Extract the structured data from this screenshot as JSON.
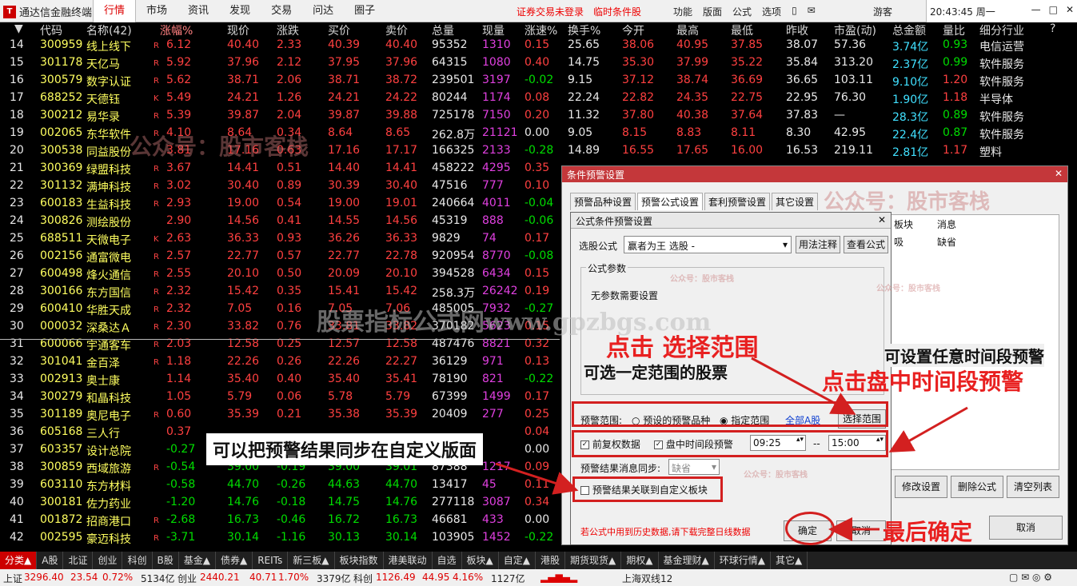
{
  "menubar": {
    "app_title": "通达信金融终端",
    "nav": [
      "行情",
      "市场",
      "资讯",
      "发现",
      "交易",
      "问达",
      "圈子"
    ],
    "warning": "证券交易未登录　临时条件股",
    "tools": [
      "功能",
      "版面",
      "公式",
      "选项"
    ],
    "user": "游客",
    "clock": "20:43:45 周一"
  },
  "table": {
    "headers": [
      "代码",
      "名称(42)",
      "涨幅%",
      "现价",
      "涨跌",
      "买价",
      "卖价",
      "总量",
      "现量",
      "涨速%",
      "换手%",
      "今开",
      "最高",
      "最低",
      "昨收",
      "市盈(动)",
      "总金额",
      "量比",
      "细分行业"
    ],
    "rows": [
      [
        "14",
        "300959",
        "线上线下",
        "R",
        "6.12",
        "40.40",
        "2.33",
        "40.39",
        "40.40",
        "95352",
        "1310",
        "0.15",
        "25.65",
        "38.06",
        "40.95",
        "37.85",
        "38.07",
        "57.36",
        "3.74亿",
        "0.93",
        "电信运营"
      ],
      [
        "15",
        "301178",
        "天亿马",
        "R",
        "5.92",
        "37.96",
        "2.12",
        "37.95",
        "37.96",
        "64315",
        "1080",
        "0.40",
        "14.75",
        "35.30",
        "37.99",
        "35.22",
        "35.84",
        "313.20",
        "2.37亿",
        "0.99",
        "软件服务"
      ],
      [
        "16",
        "300579",
        "数字认证",
        "R",
        "5.62",
        "38.71",
        "2.06",
        "38.71",
        "38.72",
        "239501",
        "3197",
        "-0.02",
        "9.15",
        "37.12",
        "38.74",
        "36.69",
        "36.65",
        "103.11",
        "9.10亿",
        "1.20",
        "软件服务"
      ],
      [
        "17",
        "688252",
        "天德钰",
        "K",
        "5.49",
        "24.21",
        "1.26",
        "24.21",
        "24.22",
        "80244",
        "1174",
        "0.08",
        "22.24",
        "22.82",
        "24.35",
        "22.75",
        "22.95",
        "76.30",
        "1.90亿",
        "1.18",
        "半导体"
      ],
      [
        "18",
        "300212",
        "易华录",
        "R",
        "5.39",
        "39.87",
        "2.04",
        "39.87",
        "39.88",
        "725178",
        "7150",
        "0.20",
        "11.32",
        "37.80",
        "40.38",
        "37.64",
        "37.83",
        "—",
        "28.3亿",
        "0.89",
        "软件服务"
      ],
      [
        "19",
        "002065",
        "东华软件",
        "R",
        "4.10",
        "8.64",
        "0.34",
        "8.64",
        "8.65",
        "262.8万",
        "21121",
        "0.00",
        "9.05",
        "8.15",
        "8.83",
        "8.11",
        "8.30",
        "42.95",
        "22.4亿",
        "0.87",
        "软件服务"
      ],
      [
        "20",
        "300538",
        "同益股份",
        "",
        "3.81",
        "17.16",
        "0.63",
        "17.16",
        "17.17",
        "166325",
        "2133",
        "-0.28",
        "14.89",
        "16.55",
        "17.65",
        "16.00",
        "16.53",
        "219.11",
        "2.81亿",
        "1.17",
        "塑料"
      ],
      [
        "21",
        "300369",
        "绿盟科技",
        "R",
        "3.67",
        "14.41",
        "0.51",
        "14.40",
        "14.41",
        "458222",
        "4295",
        "0.35",
        "",
        "",
        "",
        "",
        "",
        "",
        "",
        "",
        ""
      ],
      [
        "22",
        "301132",
        "满坤科技",
        "R",
        "3.02",
        "30.40",
        "0.89",
        "30.39",
        "30.40",
        "47516",
        "777",
        "0.10",
        "",
        "",
        "",
        "",
        "",
        "",
        "",
        "",
        ""
      ],
      [
        "23",
        "600183",
        "生益科技",
        "R",
        "2.93",
        "19.00",
        "0.54",
        "19.00",
        "19.01",
        "240664",
        "4011",
        "-0.04",
        "",
        "",
        "",
        "",
        "",
        "",
        "",
        "",
        ""
      ],
      [
        "24",
        "300826",
        "测绘股份",
        "",
        "2.90",
        "14.56",
        "0.41",
        "14.55",
        "14.56",
        "45319",
        "888",
        "-0.06",
        "",
        "",
        "",
        "",
        "",
        "",
        "",
        "",
        ""
      ],
      [
        "25",
        "688511",
        "天微电子",
        "K",
        "2.63",
        "36.33",
        "0.93",
        "36.26",
        "36.33",
        "9829",
        "74",
        "0.17",
        "",
        "",
        "",
        "",
        "",
        "",
        "",
        "",
        ""
      ],
      [
        "26",
        "002156",
        "通富微电",
        "R",
        "2.57",
        "22.77",
        "0.57",
        "22.77",
        "22.78",
        "920954",
        "8770",
        "-0.08",
        "",
        "",
        "",
        "",
        "",
        "",
        "",
        "",
        ""
      ],
      [
        "27",
        "600498",
        "烽火通信",
        "R",
        "2.55",
        "20.10",
        "0.50",
        "20.09",
        "20.10",
        "394528",
        "6434",
        "0.15",
        "",
        "",
        "",
        "",
        "",
        "",
        "",
        "",
        ""
      ],
      [
        "28",
        "300166",
        "东方国信",
        "R",
        "2.32",
        "15.42",
        "0.35",
        "15.41",
        "15.42",
        "258.3万",
        "26242",
        "0.19",
        "",
        "",
        "",
        "",
        "",
        "",
        "",
        "",
        ""
      ],
      [
        "29",
        "600410",
        "华胜天成",
        "R",
        "2.32",
        "7.05",
        "0.16",
        "7.05",
        "7.06",
        "485005",
        "7932",
        "-0.27",
        "",
        "",
        "",
        "",
        "",
        "",
        "",
        "",
        ""
      ],
      [
        "30",
        "000032",
        "深桑达Ａ",
        "R",
        "2.30",
        "33.82",
        "0.76",
        "33.81",
        "33.82",
        "370182",
        "5623",
        "0.15",
        "",
        "",
        "",
        "",
        "",
        "",
        "",
        "",
        ""
      ],
      [
        "31",
        "600066",
        "宇通客车",
        "R",
        "2.03",
        "12.58",
        "0.25",
        "12.57",
        "12.58",
        "487476",
        "8821",
        "0.32",
        "",
        "",
        "",
        "",
        "",
        "",
        "",
        "",
        ""
      ],
      [
        "32",
        "301041",
        "金百泽",
        "R",
        "1.18",
        "22.26",
        "0.26",
        "22.26",
        "22.27",
        "36129",
        "971",
        "0.13",
        "",
        "",
        "",
        "",
        "",
        "",
        "",
        "",
        ""
      ],
      [
        "33",
        "002913",
        "奥士康",
        "",
        "1.14",
        "35.40",
        "0.40",
        "35.40",
        "35.41",
        "78190",
        "821",
        "-0.22",
        "",
        "",
        "",
        "",
        "",
        "",
        "",
        "",
        ""
      ],
      [
        "34",
        "300279",
        "和晶科技",
        "",
        "1.05",
        "5.79",
        "0.06",
        "5.78",
        "5.79",
        "67399",
        "1499",
        "0.17",
        "",
        "",
        "",
        "",
        "",
        "",
        "",
        "",
        ""
      ],
      [
        "35",
        "301189",
        "奥尼电子",
        "R",
        "0.60",
        "35.39",
        "0.21",
        "35.38",
        "35.39",
        "20409",
        "277",
        "0.25",
        "",
        "",
        "",
        "",
        "",
        "",
        "",
        "",
        ""
      ],
      [
        "36",
        "605168",
        "三人行",
        "",
        "0.37",
        "",
        "",
        "",
        "",
        "",
        "",
        "0.04",
        "",
        "",
        "",
        "",
        "",
        "",
        "",
        "",
        ""
      ],
      [
        "37",
        "603357",
        "设计总院",
        "",
        "-0.27",
        "",
        "",
        "",
        "",
        "",
        "",
        "0.00",
        "",
        "",
        "",
        "",
        "",
        "",
        "",
        "",
        ""
      ],
      [
        "38",
        "300859",
        "西域旅游",
        "R",
        "-0.54",
        "39.00",
        "-0.19",
        "39.00",
        "39.01",
        "87388",
        "1217",
        "0.09",
        "",
        "",
        "",
        "",
        "",
        "",
        "",
        "",
        ""
      ],
      [
        "39",
        "603110",
        "东方材料",
        "",
        "-0.58",
        "44.70",
        "-0.26",
        "44.63",
        "44.70",
        "13417",
        "45",
        "0.11",
        "",
        "",
        "",
        "",
        "",
        "",
        "",
        "",
        ""
      ],
      [
        "40",
        "300181",
        "佐力药业",
        "",
        "-1.20",
        "14.76",
        "-0.18",
        "14.75",
        "14.76",
        "277118",
        "3087",
        "0.34",
        "",
        "",
        "",
        "",
        "",
        "",
        "",
        "",
        ""
      ],
      [
        "41",
        "001872",
        "招商港口",
        "R",
        "-2.68",
        "16.73",
        "-0.46",
        "16.72",
        "16.73",
        "46681",
        "433",
        "0.00",
        "",
        "",
        "",
        "",
        "",
        "",
        "",
        "",
        ""
      ],
      [
        "42",
        "002595",
        "豪迈科技",
        "R",
        "-3.71",
        "30.14",
        "-1.16",
        "30.13",
        "30.14",
        "103905",
        "1452",
        "-0.22",
        "",
        "",
        "",
        "",
        "",
        "",
        "",
        "",
        ""
      ]
    ]
  },
  "blockbar": [
    "分类▲",
    "A股",
    "北证",
    "创业",
    "科创",
    "B股",
    "基金▲",
    "债券▲",
    "REITs",
    "新三板▲",
    "板块指数",
    "港美联动",
    "自选",
    "板块▲",
    "自定▲",
    "港股",
    "期货现货▲",
    "期权▲",
    "基金理财▲",
    "环球行情▲",
    "其它▲"
  ],
  "statusbar": {
    "sh_label": "上证",
    "sh_val": "3296.40",
    "sh_chg": "23.54",
    "sh_pct": "0.72%",
    "sh_amt": "5134亿",
    "cy_label": "创业",
    "cy_val": "2440.21",
    "cy_chg": "40.71",
    "cy_pct": "1.70%",
    "cy_amt": "3379亿",
    "kc_label": "科创",
    "kc_val": "1126.49",
    "kc_chg": "44.95",
    "kc_pct": "4.16%",
    "kc_amt": "1127亿",
    "ticker": "上海双线12"
  },
  "outer_dialog": {
    "title": "条件预警设置",
    "tabs": [
      "预警品种设置",
      "预警公式设置",
      "套利预警设置",
      "其它设置"
    ],
    "list_headers": [
      "板块",
      "消息"
    ],
    "list_row": [
      "吸",
      "缺省"
    ],
    "buttons": [
      "修改设置",
      "删除公式",
      "清空列表"
    ],
    "cancel": "取消"
  },
  "inner_dialog": {
    "title": "公式条件预警设置",
    "formula_label": "选股公式",
    "formula_value": "赢者为王 选股 -",
    "usage_btn": "用法注释",
    "view_btn": "查看公式",
    "params_label": "公式参数",
    "params_text": "无参数需要设置",
    "range_label": "预警范围:",
    "range_opt1": "预设的预警品种",
    "range_opt2": "指定范围",
    "range_value": "全部A股",
    "range_btn": "选择范围",
    "pre_adj": "前复权数据",
    "intraday": "盘中时间段预警",
    "time_from": "09:25",
    "time_to": "15:00",
    "sync_label": "预警结果消息同步:",
    "sync_value": "缺省",
    "link_label": "预警结果关联到自定义板块",
    "note": "若公式中用到历史数据,请下载完整日线数据",
    "ok": "确定",
    "cancel": "取消"
  },
  "annotations": {
    "click_range": "点击 选择范围",
    "can_select": "可选一定范围的股票",
    "any_time": "可设置任意时间段预警",
    "click_intraday": "点击盘中时间段预警",
    "sync_result": "可以把预警结果同步在自定义版面",
    "final_ok": "最后确定"
  },
  "watermarks": {
    "gzh": "公众号：股市客栈",
    "site": "股票指标公式网www.gpzbgs.com"
  },
  "colors": {
    "title_red": "#c4373a",
    "annot_red": "#e82020",
    "stock_name": "#f0f020"
  }
}
